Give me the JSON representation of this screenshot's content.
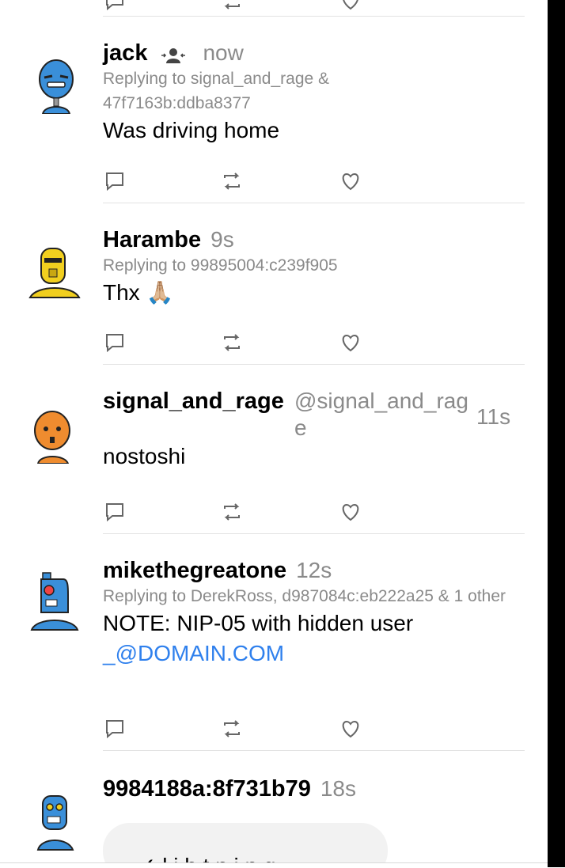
{
  "posts": [
    {
      "name": "jack",
      "time": "now",
      "reply": "Replying to signal_and_rage & 47f7163b:ddba8377",
      "body": "Was driving home"
    },
    {
      "name": "Harambe",
      "time": "9s",
      "reply": "Replying to 99895004:c239f905",
      "body": "Thx 🙏🏼"
    },
    {
      "name": "signal_and_rage",
      "handle": "@signal_and_rage",
      "time": "11s",
      "body": "nostoshi"
    },
    {
      "name": "mikethegreatone",
      "time": "12s",
      "reply": "Replying to DerekRoss, d987084c:eb222a25 & 1 other",
      "body": "NOTE: NIP-05 with hidden user",
      "link": "_@DOMAIN.COM"
    },
    {
      "name": "9984188a:8f731b79",
      "time": "18s",
      "preview_text": "✓ l i h t n i n g  ..."
    }
  ],
  "icons": {
    "reply": "comment-icon",
    "repost": "repost-icon",
    "like": "heart-icon",
    "follow": "follows-you-icon"
  },
  "colors": {
    "muted": "#8a8a8a",
    "link": "#2f80ed",
    "avatar_blue": "#3a8fd9",
    "avatar_yellow": "#f1cf1f",
    "avatar_orange": "#ef8c2f"
  }
}
